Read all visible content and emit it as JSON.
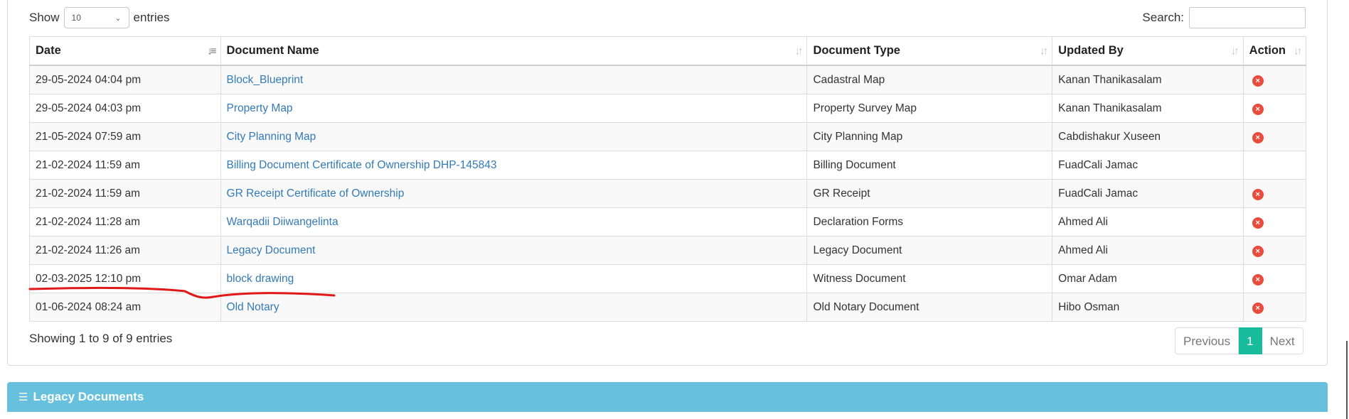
{
  "length_control": {
    "show_label": "Show",
    "selected": "10",
    "entries_label": "entries"
  },
  "search": {
    "label": "Search:",
    "value": ""
  },
  "table": {
    "columns": [
      "Date",
      "Document Name",
      "Document Type",
      "Updated By",
      "Action"
    ],
    "rows": [
      {
        "date": "29-05-2024 04:04 pm",
        "name": "Block_Blueprint",
        "type": "Cadastral Map",
        "updated_by": "Kanan Thanikasalam",
        "deletable": true
      },
      {
        "date": "29-05-2024 04:03 pm",
        "name": "Property Map",
        "type": "Property Survey Map",
        "updated_by": "Kanan Thanikasalam",
        "deletable": true
      },
      {
        "date": "21-05-2024 07:59 am",
        "name": "City Planning Map",
        "type": "City Planning Map",
        "updated_by": "Cabdishakur Xuseen",
        "deletable": true
      },
      {
        "date": "21-02-2024 11:59 am",
        "name": "Billing Document Certificate of Ownership DHP-145843",
        "type": "Billing Document",
        "updated_by": "FuadCali Jamac",
        "deletable": false
      },
      {
        "date": "21-02-2024 11:59 am",
        "name": "GR Receipt Certificate of Ownership",
        "type": "GR Receipt",
        "updated_by": "FuadCali Jamac",
        "deletable": true
      },
      {
        "date": "21-02-2024 11:28 am",
        "name": "Warqadii Diiwangelinta",
        "type": "Declaration Forms",
        "updated_by": "Ahmed Ali",
        "deletable": true
      },
      {
        "date": "21-02-2024 11:26 am",
        "name": "Legacy Document",
        "type": "Legacy Document",
        "updated_by": "Ahmed Ali",
        "deletable": true
      },
      {
        "date": "02-03-2025 12:10 pm",
        "name": "block drawing",
        "type": "Witness Document",
        "updated_by": "Omar Adam",
        "deletable": true
      },
      {
        "date": "01-06-2024 08:24 am",
        "name": "Old Notary",
        "type": "Old Notary Document",
        "updated_by": "Hibo Osman",
        "deletable": true
      }
    ]
  },
  "info": "Showing 1 to 9 of 9 entries",
  "pagination": {
    "previous": "Previous",
    "current": "1",
    "next": "Next"
  },
  "legacy_section": {
    "title": "Legacy Documents"
  },
  "colors": {
    "link": "#337ab7",
    "active_page": "#18bc9c",
    "section_header": "#67c1dd",
    "delete_icon": "#e74c3c",
    "annotation_stroke": "#e01818"
  }
}
